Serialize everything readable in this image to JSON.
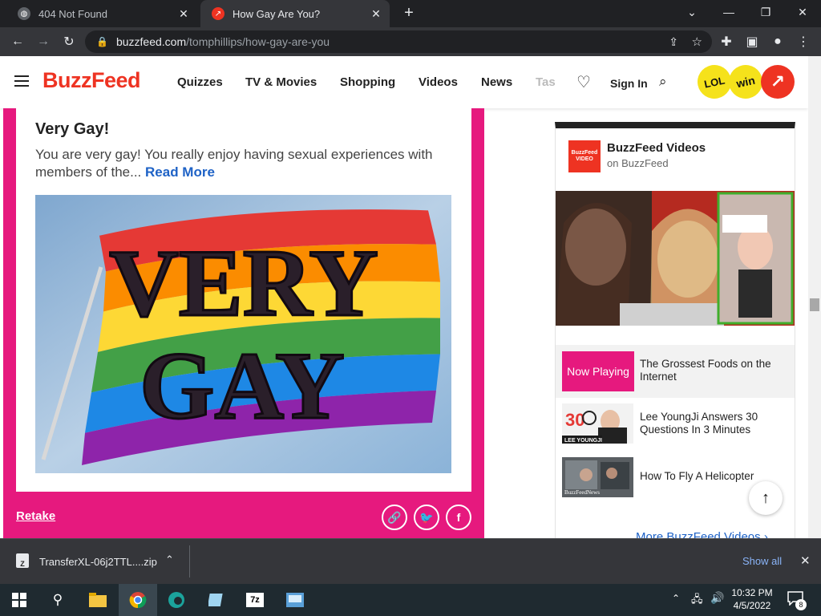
{
  "browser": {
    "tabs": [
      {
        "title": "404 Not Found",
        "active": false
      },
      {
        "title": "How Gay Are You?",
        "active": true
      }
    ],
    "new_tab": "+",
    "url_domain": "buzzfeed.com",
    "url_path": "/tomphillips/how-gay-are-you"
  },
  "header": {
    "logo": "BuzzFeed",
    "nav": [
      "Quizzes",
      "TV & Movies",
      "Shopping",
      "Videos",
      "News",
      "Tas"
    ],
    "signin": "Sign In",
    "badges": [
      "LOL",
      "win"
    ]
  },
  "result": {
    "title": "Very Gay!",
    "description": "You are very gay! You really enjoy having sexual experiences with members of the...",
    "read_more": "Read More",
    "image_text": [
      "VERY",
      "GAY"
    ],
    "retake": "Retake"
  },
  "video_widget": {
    "logo_text": "BuzzFeed VIDEO",
    "title": "BuzzFeed Videos",
    "subtitle": "on BuzzFeed",
    "now_playing_label": "Now Playing",
    "now_playing_title": "The Grossest Foods on the Internet",
    "items": [
      {
        "title": "Lee YoungJi Answers 30 Questions In 3 Minutes",
        "thumb_label": "LEE YOUNGJI"
      },
      {
        "title": "How To Fly A Helicopter",
        "thumb_label": "BuzzFeedNews"
      }
    ],
    "more": "More BuzzFeed Videos"
  },
  "download_bar": {
    "filename": "TransferXL-06j2TTL....zip",
    "show_all": "Show all"
  },
  "taskbar": {
    "time": "10:32 PM",
    "date": "4/5/2022",
    "notification_count": "8"
  }
}
